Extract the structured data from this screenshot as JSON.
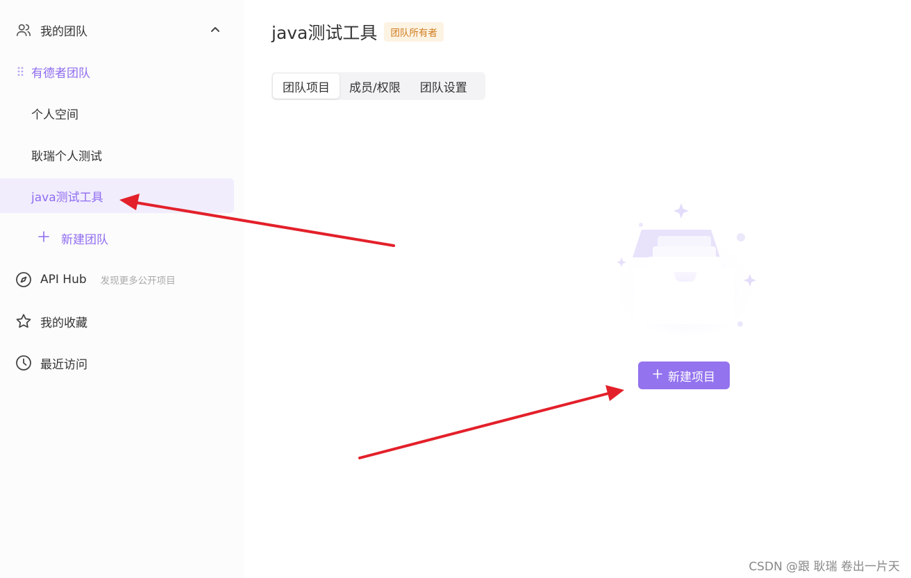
{
  "sidebar": {
    "my_teams_label": "我的团队",
    "teams": [
      {
        "label": "有德者团队"
      },
      {
        "label": "个人空间"
      },
      {
        "label": "耿瑞个人测试"
      },
      {
        "label": "java测试工具"
      }
    ],
    "new_team_label": "新建团队",
    "api_hub_label": "API Hub",
    "api_hub_sub": "发现更多公开项目",
    "favorites_label": "我的收藏",
    "recent_label": "最近访问"
  },
  "header": {
    "title": "java测试工具",
    "badge": "团队所有者"
  },
  "tabs": [
    {
      "label": "团队项目"
    },
    {
      "label": "成员/权限"
    },
    {
      "label": "团队设置"
    }
  ],
  "empty_state": {
    "new_project_label": "新建项目"
  },
  "watermark": "CSDN @跟 耿瑞 卷出一片天",
  "colors": {
    "accent": "#9373ee",
    "active_bg": "#f1edfd",
    "badge_text": "#d07c1e",
    "badge_bg": "#fdf3e3",
    "annotation_arrow": "#e3202a"
  }
}
